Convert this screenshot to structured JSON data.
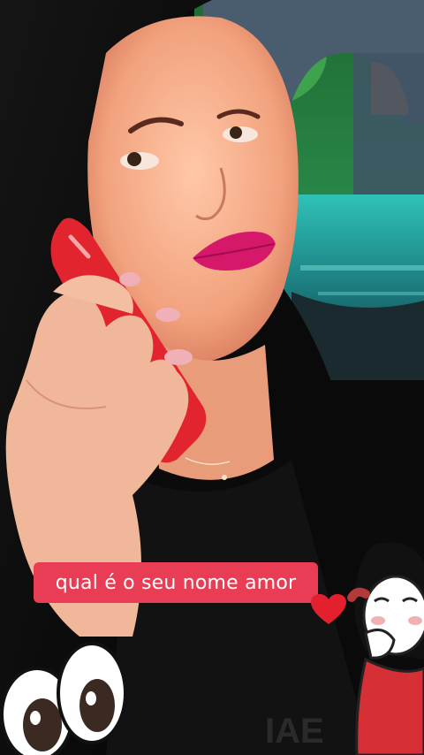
{
  "story": {
    "caption": "qual é o seu nome amor"
  },
  "stickers": {
    "heart": "heart-icon",
    "eyes": "googly-eyes-icon",
    "girl": "shy-girl-sticker"
  },
  "colors": {
    "caption_bg": "#e83d54",
    "caption_text": "#ffffff",
    "lipstick": "#d6186b",
    "heart": "#e3202d",
    "water": "#27b3a9"
  }
}
